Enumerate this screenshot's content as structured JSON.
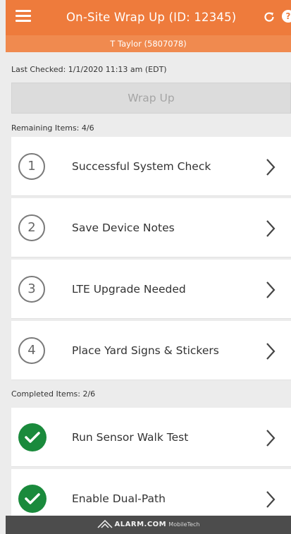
{
  "header": {
    "title": "On-Site Wrap Up (ID: 12345)",
    "subtitle": "T Taylor (5807078)",
    "menu_icon": "hamburger-menu-icon",
    "refresh_icon": "refresh-icon",
    "help_icon": "help-icon",
    "help_glyph": "?",
    "color": "#ee7b3c"
  },
  "status": {
    "last_checked": "Last Checked: 1/1/2020 11:13 am (EDT)"
  },
  "wrapup_button": {
    "label": "Wrap Up",
    "state": "disabled"
  },
  "remaining": {
    "label": "Remaining Items: 4/6",
    "items": [
      {
        "number": "1",
        "label": "Successful System Check"
      },
      {
        "number": "2",
        "label": "Save Device Notes"
      },
      {
        "number": "3",
        "label": "LTE Upgrade Needed"
      },
      {
        "number": "4",
        "label": "Place Yard Signs & Stickers"
      }
    ]
  },
  "completed": {
    "label": "Completed Items: 2/6",
    "items": [
      {
        "label": "Run Sensor Walk Test",
        "icon": "checkmark-icon"
      },
      {
        "label": "Enable Dual-Path",
        "icon": "checkmark-icon"
      }
    ],
    "check_color": "#1a8a3c"
  },
  "footer": {
    "brand": "ALARM.COM",
    "product": "MobileTech"
  }
}
